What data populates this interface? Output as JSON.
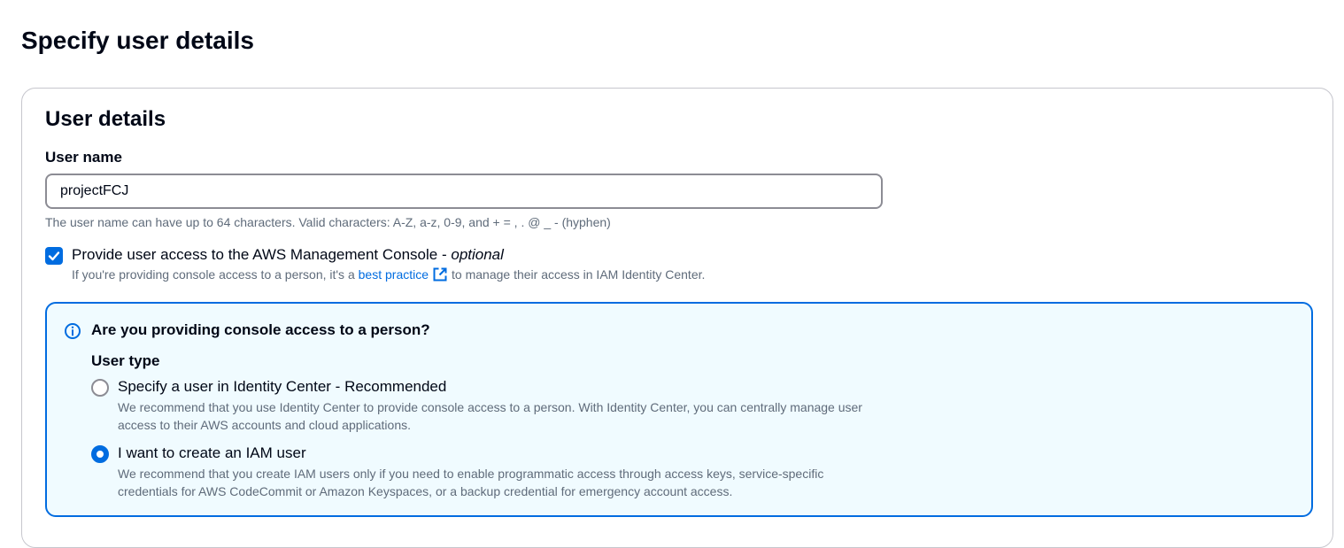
{
  "page": {
    "title": "Specify user details"
  },
  "user_details": {
    "title": "User details",
    "user_name": {
      "label": "User name",
      "value": "projectFCJ",
      "hint": "The user name can have up to 64 characters. Valid characters: A-Z, a-z, 0-9, and + = , . @ _ - (hyphen)"
    },
    "console_access": {
      "checked": true,
      "label": "Provide user access to the AWS Management Console - ",
      "label_optional": "optional",
      "desc_before": "If you're providing console access to a person, it's a ",
      "desc_link": "best practice",
      "desc_after": "to manage their access in IAM Identity Center."
    }
  },
  "info_box": {
    "icon": "info-icon",
    "header": "Are you providing console access to a person?",
    "user_type_label": "User type",
    "options": [
      {
        "label": "Specify a user in Identity Center - Recommended",
        "description": "We recommend that you use Identity Center to provide console access to a person. With Identity Center, you can centrally manage user access to their AWS accounts and cloud applications.",
        "selected": false
      },
      {
        "label": "I want to create an IAM user",
        "description": "We recommend that you create IAM users only if you need to enable programmatic access through access keys, service-specific credentials for AWS CodeCommit or Amazon Keyspaces, or a backup credential for emergency account access.",
        "selected": true
      }
    ]
  },
  "colors": {
    "accent": "#006ce0",
    "info_background": "#f0fbff",
    "text": "#000716",
    "secondary_text": "#5f6b7a"
  }
}
